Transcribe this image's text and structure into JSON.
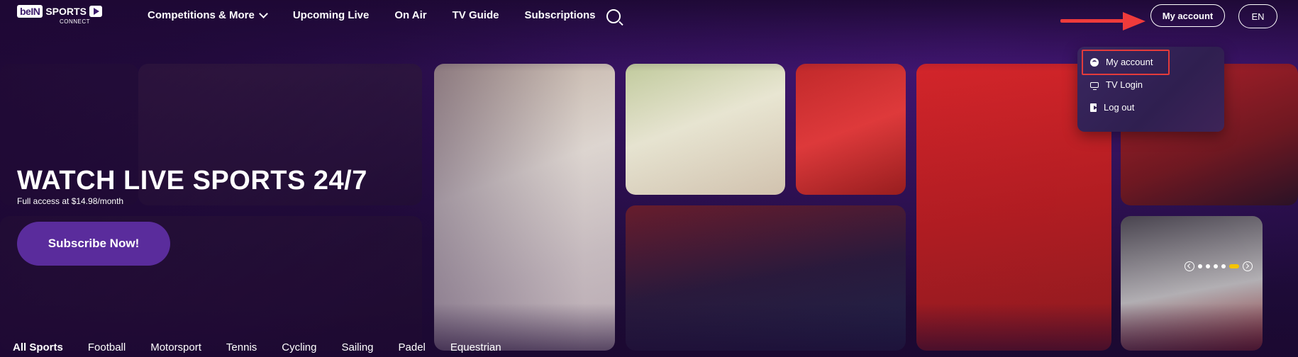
{
  "brand": {
    "logo_text_1": "beIN",
    "logo_text_2": "SPORTS",
    "logo_text_3": "CONNECT"
  },
  "nav": {
    "items": [
      {
        "label": "Competitions & More",
        "has_dropdown": true
      },
      {
        "label": "Upcoming Live"
      },
      {
        "label": "On Air"
      },
      {
        "label": "TV Guide"
      },
      {
        "label": "Subscriptions"
      }
    ],
    "search_icon": "search-icon"
  },
  "header": {
    "account_label": "My account",
    "language_label": "EN"
  },
  "account_menu": {
    "items": [
      {
        "label": "My account",
        "icon": "user-circle-icon"
      },
      {
        "label": "TV Login",
        "icon": "tv-icon"
      },
      {
        "label": "Log out",
        "icon": "logout-icon"
      }
    ],
    "highlight_color": "#e43b3b"
  },
  "hero": {
    "title": "WATCH LIVE SPORTS 24/7",
    "subtitle": "Full access at $14.98/month",
    "cta_label": "Subscribe Now!"
  },
  "carousel": {
    "slide_count": 5,
    "active_index": 4,
    "active_color": "#f5c400"
  },
  "sports_tabs": {
    "items": [
      {
        "label": "All Sports",
        "active": true
      },
      {
        "label": "Football"
      },
      {
        "label": "Motorsport"
      },
      {
        "label": "Tennis"
      },
      {
        "label": "Cycling"
      },
      {
        "label": "Sailing"
      },
      {
        "label": "Padel"
      },
      {
        "label": "Equestrian"
      }
    ]
  },
  "colors": {
    "background": "#1d0b33",
    "accent": "#5a2c9c",
    "annotation_arrow": "#ef3b3b"
  }
}
